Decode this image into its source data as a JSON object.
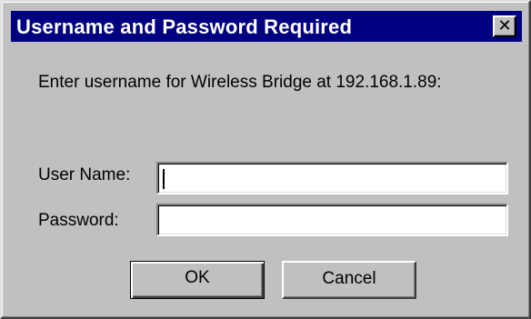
{
  "window": {
    "title": "Username and Password Required",
    "close_glyph": "✕"
  },
  "prompt": "Enter username for Wireless Bridge at 192.168.1.89:",
  "form": {
    "username_label": "User Name:",
    "username_value": "",
    "password_label": "Password:",
    "password_value": ""
  },
  "buttons": {
    "ok": "OK",
    "cancel": "Cancel"
  },
  "colors": {
    "titlebar": "#000080",
    "dialog_bg": "#c0c0c0"
  }
}
